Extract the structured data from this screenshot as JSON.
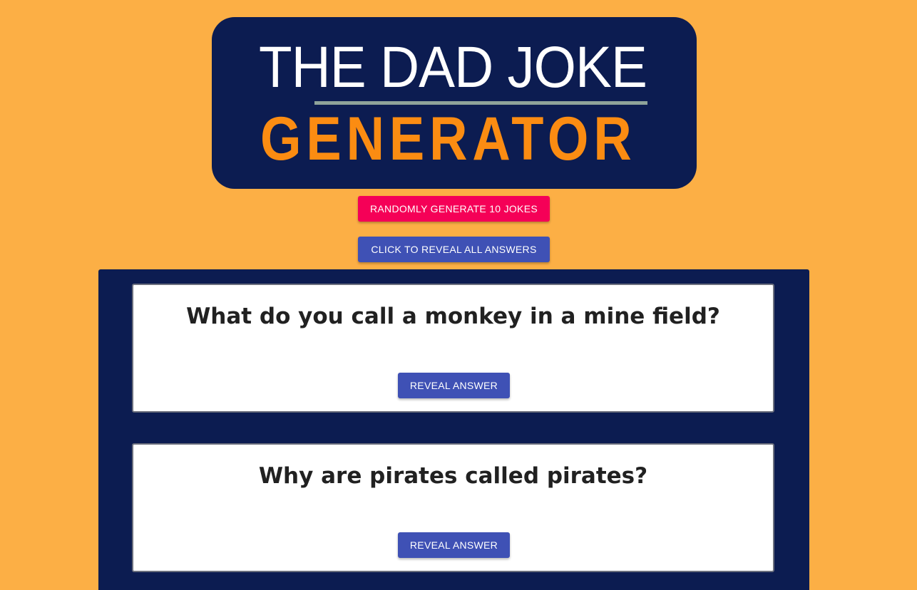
{
  "logo": {
    "line1": "THE DAD JOKE",
    "line2": "GENERATOR"
  },
  "controls": {
    "generate_label": "RANDOMLY GENERATE 10 JOKES",
    "reveal_all_label": "CLICK TO REVEAL ALL ANSWERS"
  },
  "jokes": [
    {
      "question": "What do you call a monkey in a mine field?",
      "reveal_label": "REVEAL ANSWER"
    },
    {
      "question": "Why are pirates called pirates?",
      "reveal_label": "REVEAL ANSWER"
    }
  ],
  "colors": {
    "background": "#fcaf45",
    "navy": "#0c1c51",
    "logo_orange": "#fb8c12",
    "generate_button": "#f50057",
    "primary_button": "#3f51b5"
  }
}
